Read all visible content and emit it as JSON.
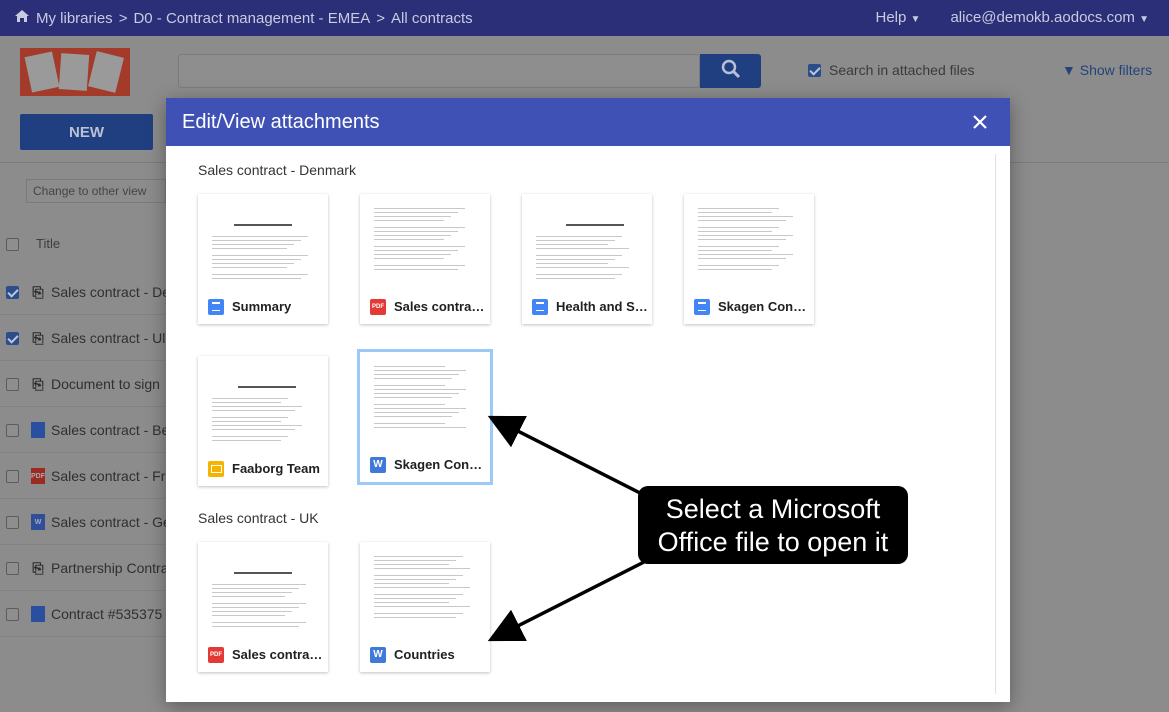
{
  "topbar": {
    "home_icon": "home-icon",
    "breadcrumb": [
      "My libraries",
      ">",
      "D0 - Contract management - EMEA",
      ">",
      "All contracts"
    ],
    "help_label": "Help",
    "user_label": "alice@demokb.aodocs.com"
  },
  "toolbar": {
    "new_label": "NEW",
    "search_placeholder": "",
    "search_in_attached_label": "Search in attached files",
    "show_filters_label": "Show filters",
    "change_view_label": "Change to other view"
  },
  "list": {
    "title_header": "Title",
    "rows": [
      {
        "checked": true,
        "icon": "paperclip-doc-icon",
        "label": "Sales contract - De"
      },
      {
        "checked": true,
        "icon": "paperclip-doc-icon",
        "label": "Sales contract - Ul"
      },
      {
        "checked": false,
        "icon": "paperclip-doc-icon",
        "label": "Document to sign"
      },
      {
        "checked": false,
        "icon": "gdoc-icon",
        "label": "Sales contract - Be"
      },
      {
        "checked": false,
        "icon": "pdf-icon",
        "label": "Sales contract - Fra"
      },
      {
        "checked": false,
        "icon": "word-icon",
        "label": "Sales contract - Ge"
      },
      {
        "checked": false,
        "icon": "paperclip-doc-icon",
        "label": "Partnership Contra"
      },
      {
        "checked": false,
        "icon": "file-icon",
        "label": "Contract #535375"
      }
    ]
  },
  "modal": {
    "title": "Edit/View attachments",
    "sections": [
      {
        "title": "Sales contract - Denmark",
        "files": [
          {
            "label": "Summary",
            "type": "gdoc"
          },
          {
            "label": "Sales contra…",
            "type": "pdf"
          },
          {
            "label": "Health and S…",
            "type": "gdoc"
          },
          {
            "label": "Skagen Con…",
            "type": "gdoc"
          },
          {
            "label": "Faaborg Team",
            "type": "slides"
          },
          {
            "label": "Skagen Con…",
            "type": "word",
            "selected": true
          }
        ]
      },
      {
        "title": "Sales contract - UK",
        "files": [
          {
            "label": "Sales contra…",
            "type": "pdf"
          },
          {
            "label": "Countries",
            "type": "word"
          }
        ]
      }
    ]
  },
  "annotation": {
    "line1": "Select a Microsoft",
    "line2": "Office file to open it"
  },
  "colors": {
    "header_blue": "#3f51b5",
    "topbar_dim": "#2a2f78",
    "callout_bg": "#000000"
  }
}
